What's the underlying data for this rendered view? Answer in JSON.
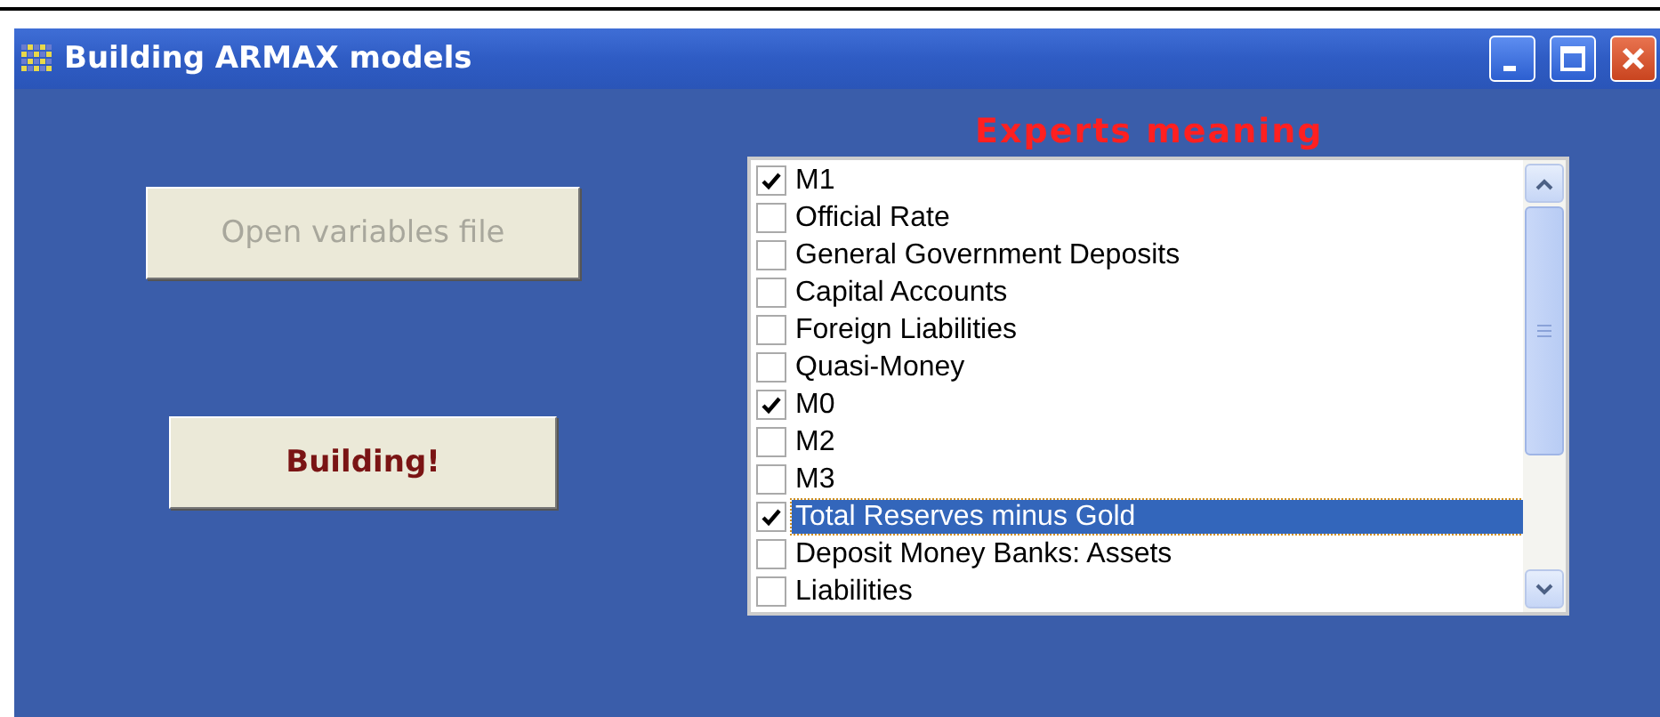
{
  "window": {
    "title": "Building ARMAX models"
  },
  "buttons": [
    {
      "label": "Open variables file",
      "disabled": true
    },
    {
      "label": "Building!",
      "disabled": false
    }
  ],
  "list": {
    "title": "Experts meaning",
    "items": [
      {
        "label": "M1",
        "checked": true,
        "selected": false
      },
      {
        "label": "Official Rate",
        "checked": false,
        "selected": false
      },
      {
        "label": "General Government Deposits",
        "checked": false,
        "selected": false
      },
      {
        "label": "Capital Accounts",
        "checked": false,
        "selected": false
      },
      {
        "label": "Foreign Liabilities",
        "checked": false,
        "selected": false
      },
      {
        "label": "Quasi-Money",
        "checked": false,
        "selected": false
      },
      {
        "label": "M0",
        "checked": true,
        "selected": false
      },
      {
        "label": "M2",
        "checked": false,
        "selected": false
      },
      {
        "label": "M3",
        "checked": false,
        "selected": false
      },
      {
        "label": "Total Reserves minus Gold",
        "checked": true,
        "selected": true
      },
      {
        "label": "Deposit Money Banks: Assets",
        "checked": false,
        "selected": false
      },
      {
        "label": "Liabilities",
        "checked": false,
        "selected": false
      }
    ]
  }
}
